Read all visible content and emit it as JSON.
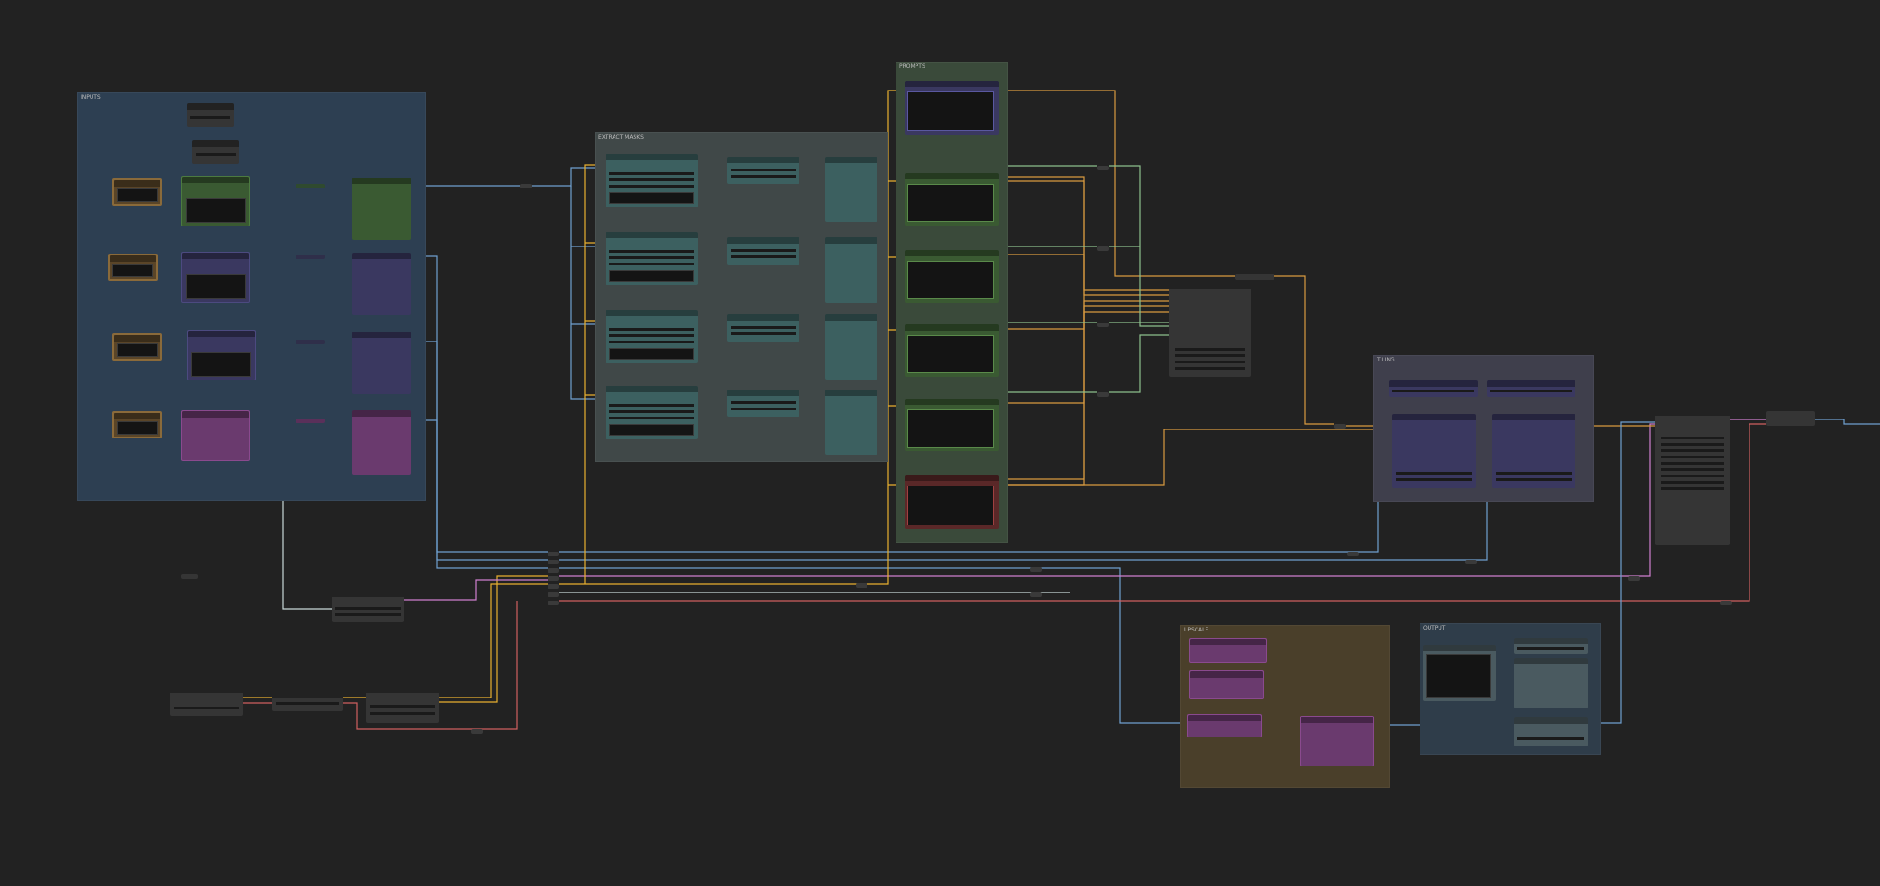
{
  "canvas": {
    "background": "#222222"
  },
  "groups": [
    {
      "id": "inputs",
      "title": "INPUTS",
      "color": "#2d3f52"
    },
    {
      "id": "masks",
      "title": "EXTRACT MASKS",
      "color": "#404848"
    },
    {
      "id": "prompts",
      "title": "PROMPTS",
      "color": "#3a4a3a"
    },
    {
      "id": "tiles",
      "title": "TILING",
      "color": "#3f3f4c"
    },
    {
      "id": "upscale",
      "title": "UPSCALE",
      "color": "#4a3f2a"
    },
    {
      "id": "output",
      "title": "OUTPUT",
      "color": "#2f3d4a"
    }
  ],
  "colors": {
    "wire_blue": "#6fa0d0",
    "wire_yellow": "#e8b030",
    "wire_orange": "#d89a40",
    "wire_green": "#8cc08c",
    "wire_pink": "#d080d0",
    "wire_red": "#d06060",
    "wire_white": "#c8d8d8",
    "node_green": "#3a5a32",
    "node_purple": "#3a3860",
    "node_teal": "#3c6060",
    "node_magenta": "#6a3a6e",
    "node_brown": "#5a4528",
    "node_gray": "#353535",
    "node_red": "#5a2828"
  }
}
